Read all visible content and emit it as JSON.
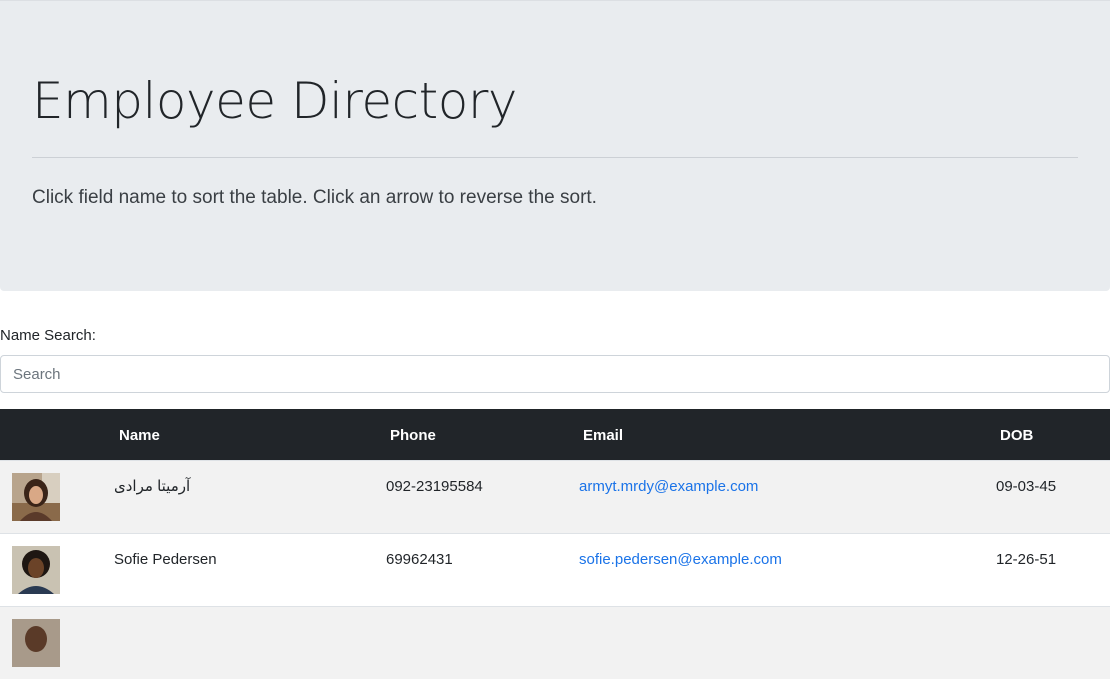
{
  "header": {
    "title": "Employee Directory",
    "subtitle": "Click field name to sort the table. Click an arrow to reverse the sort."
  },
  "search": {
    "label": "Name Search:",
    "placeholder": "Search",
    "value": ""
  },
  "table": {
    "columns": [
      "Name",
      "Phone",
      "Email",
      "DOB"
    ],
    "rows": [
      {
        "name": "آرمیتا مرادی",
        "phone": "092-23195584",
        "email": "armyt.mrdy@example.com",
        "dob": "09-03-45"
      },
      {
        "name": "Sofie Pedersen",
        "phone": "69962431",
        "email": "sofie.pedersen@example.com",
        "dob": "12-26-51"
      },
      {
        "name": "",
        "phone": "",
        "email": "",
        "dob": ""
      }
    ]
  },
  "colors": {
    "jumbotron_bg": "#e9ecef",
    "table_header_bg": "#212529",
    "link": "#1a73e8",
    "striped_row": "#f2f2f2"
  }
}
